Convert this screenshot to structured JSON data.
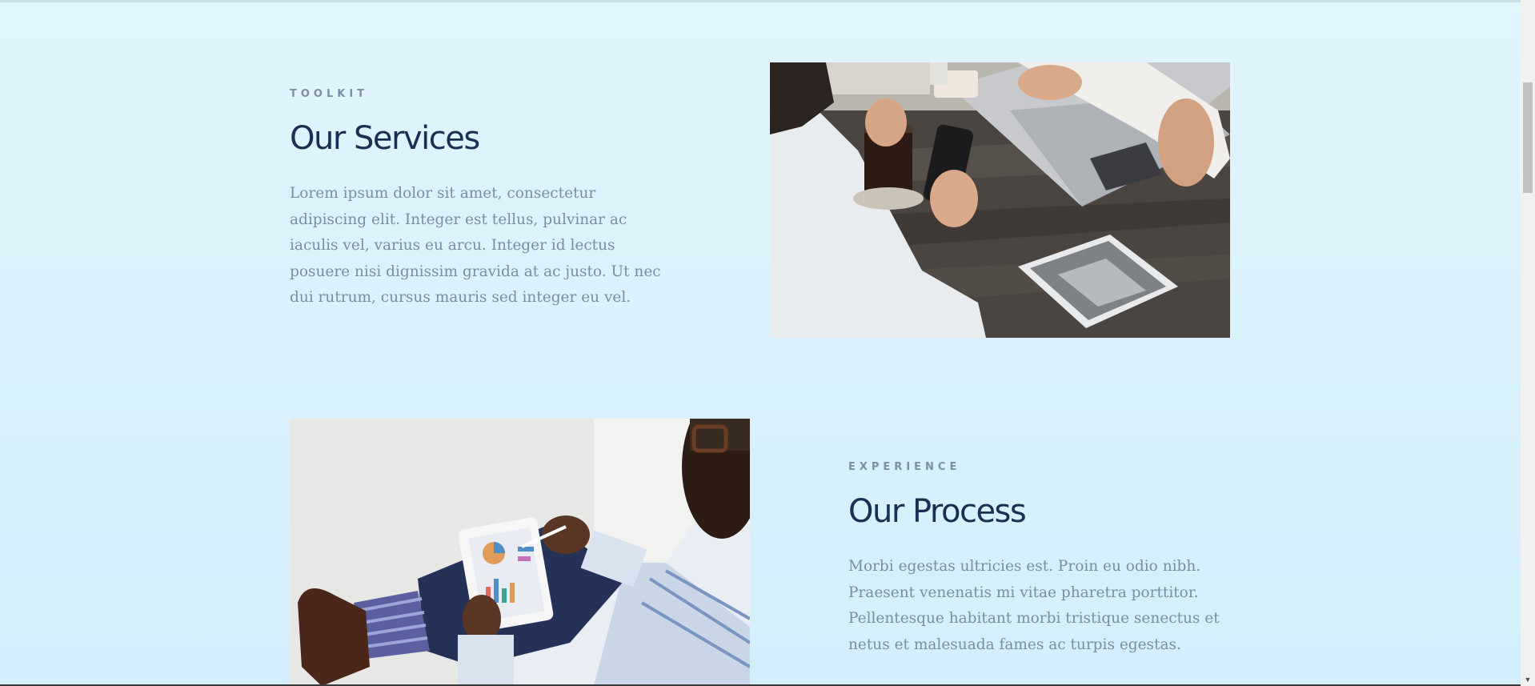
{
  "services": {
    "eyebrow": "TOOLKIT",
    "title": "Our Services",
    "body": "Lorem ipsum dolor sit amet, consectetur adipiscing elit. Integer est tellus, pulvinar ac iaculis vel, varius eu arcu. Integer id lectus posuere nisi dignissim gravida at ac justo. Ut nec dui rutrum, cursus mauris sed integer eu vel."
  },
  "process": {
    "eyebrow": "EXPERIENCE",
    "title": "Our Process",
    "body": "Morbi egestas ultricies est. Proin eu odio nibh. Praesent venenatis mi vitae pharetra porttitor. Pellentesque habitant morbi tristique senectus et netus et malesuada fames ac turpis egestas."
  },
  "colors": {
    "background": "#dff4fd",
    "heading": "#1d2e54",
    "eyebrow": "#7e8ea6",
    "body": "#7c8ca6"
  }
}
